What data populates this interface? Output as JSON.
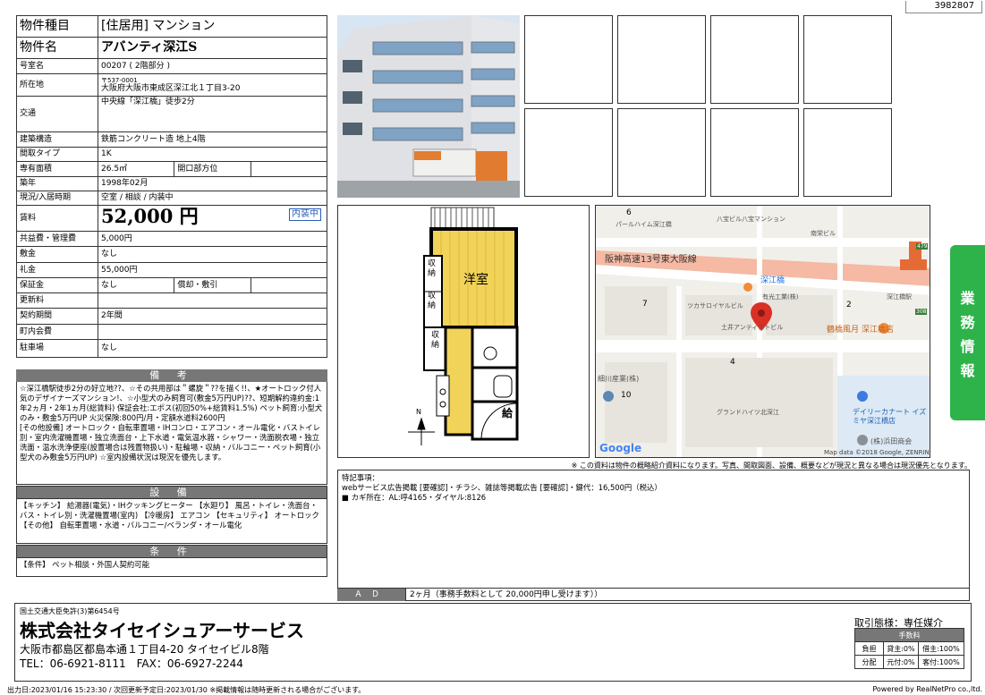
{
  "doc_id": "3982807",
  "property": {
    "type_label": "物件種目",
    "type_value": "[住居用] マンション",
    "name_label": "物件名",
    "name_value": "アバンティ深江S",
    "room_label": "号室名",
    "room_value": "00207 ( 2階部分 )",
    "address_label": "所在地",
    "zip": "〒537-0001",
    "address": "大阪府大阪市東成区深江北１丁目3-20",
    "traffic_label": "交通",
    "traffic": "中央線「深江橋」徒歩2分",
    "structure_label": "建築構造",
    "structure": "鉄筋コンクリート造 地上4階",
    "layout_label": "間取タイプ",
    "layout": "1K",
    "area_label": "専有面積",
    "area": "26.5㎡",
    "opening_label": "開口部方位",
    "opening": "",
    "built_label": "築年",
    "built": "1998年02月",
    "status_label": "現況/入居時期",
    "status": "空室 / 相談 / 内装中",
    "rent_label": "賃料",
    "rent": "52,000 円",
    "rent_badge": "内装中",
    "common_label": "共益費・管理費",
    "common": "5,000円",
    "deposit_label": "敷金",
    "deposit": "なし",
    "key_money_label": "礼金",
    "key_money": "55,000円",
    "guarantee_label": "保証金",
    "guarantee": "なし",
    "amort_label": "償却・敷引",
    "amort": "",
    "renewal_label": "更新料",
    "renewal": "",
    "contract_label": "契約期間",
    "contract": "2年間",
    "town_label": "町内会費",
    "town": "",
    "parking_label": "駐車場",
    "parking": "なし"
  },
  "sections": {
    "remarks_title": "備 考",
    "remarks": "☆深江橋駅徒歩2分の好立地??、☆その共用部は＂螺旋＂??を描く!!、★オートロック付人気のデザイナーズマンション!、☆小型犬のみ飼育可(敷金5万円UP)??、短期解約違約金:1年2ヵ月・2年1ヵ月(総賃料) 保証会社:エポス(初回50%+総賃料1.5%) ペット飼育:小型犬のみ・敷金5万円UP 火災保険:800円/月・定額水道料2600円\n[その他設備] オートロック・自転車置場・IHコンロ・エアコン・オール電化・バストイレ別・室内洗濯機置場・独立洗面台・上下水道・電気温水器・シャワー・洗面脱衣場・独立洗面・温水洗浄便座(設置場合は残置物扱い)・駐輪場・収納・バルコニー・ペット飼育(小型犬のみ敷金5万円UP) ☆室内設備状況は現況を優先します。",
    "equipment_title": "設 備",
    "equipment": "【キッチン】 給湯器(電気)・IHクッキングヒーター 【水廻り】 風呂・トイレ・洗面台・バス・トイレ別・洗濯機置場(室内) 【冷暖房】 エアコン 【セキュリティ】 オートロック 【その他】 自転車置場・水道・バルコニー/ベランダ・オール電化",
    "conditions_title": "条 件",
    "conditions": "【条件】 ペット相談・外国人契約可能"
  },
  "floor_plan": {
    "room": "洋室",
    "storage": "収納",
    "storage2": "収納",
    "storage3": "収納",
    "kitchen_storage": "給",
    "north": "N"
  },
  "map": {
    "labels": [
      "パールハイム深江橋",
      "八宝ビル八宝マンション",
      "南栄ビル",
      "阪神高速13号東大阪線",
      "深江橋",
      "有光工業(株)",
      "深江橋駅",
      "ツカサロイヤルビル",
      "土井アンティストビル",
      "鶴橋風月 深江橋店",
      "細川産業(株)",
      "グランドハイツ北深江",
      "デイリーカナート イズミヤ深江橋店",
      "(株)浜田商会"
    ],
    "numbers": [
      "6",
      "7",
      "2",
      "4",
      "10",
      "479",
      "308"
    ],
    "google": "Google",
    "attribution": "Map data ©2018 Google, ZENRIN"
  },
  "disclaimer": "※ この資料は物件の概略紹介資料になります。写真、間取図面、設備、概要などが現況と異なる場合は現況優先となります。",
  "notes": {
    "title": "特記事項：",
    "line1": "webサービス広告掲載 [要確認]・チラシ、雑誌等掲載広告 [要確認]・鍵代：16,500円（税込）",
    "line2": "■ カギ所在：AL:呼4165・ダイヤル:8126"
  },
  "ad": {
    "label": "ＡＤ",
    "value": "2ヶ月（事務手数料として 20,000円申し受けます））"
  },
  "side_tab": "業務情報",
  "company": {
    "license": "国土交通大臣免許(3)第6454号",
    "name": "株式会社タイセイシュアーサービス",
    "address": "大阪市都島区都島本通１丁目4-20 タイセイビル8階",
    "tel_fax": "TEL：06-6921-8111　FAX：06-6927-2244"
  },
  "transaction": {
    "mode": "取引態様：専任媒介",
    "fee_header": "手数料",
    "row1_label": "負担",
    "row1_a": "貸主:0%",
    "row1_b": "借主:100%",
    "row2_label": "分配",
    "row2_a": "元付:0%",
    "row2_b": "客付:100%"
  },
  "footer_bar": {
    "printed": "出力日:2023/01/16 15:23:30 / 次回更新予定日:2023/01/30 ※掲載情報は随時更新される場合がございます。",
    "powered": "Powered by RealNetPro co.,ltd."
  },
  "colors": {
    "side_tab": "#2db34a",
    "section_bg": "#777777",
    "badge": "#2b5fb8",
    "pin": "#d93025"
  }
}
